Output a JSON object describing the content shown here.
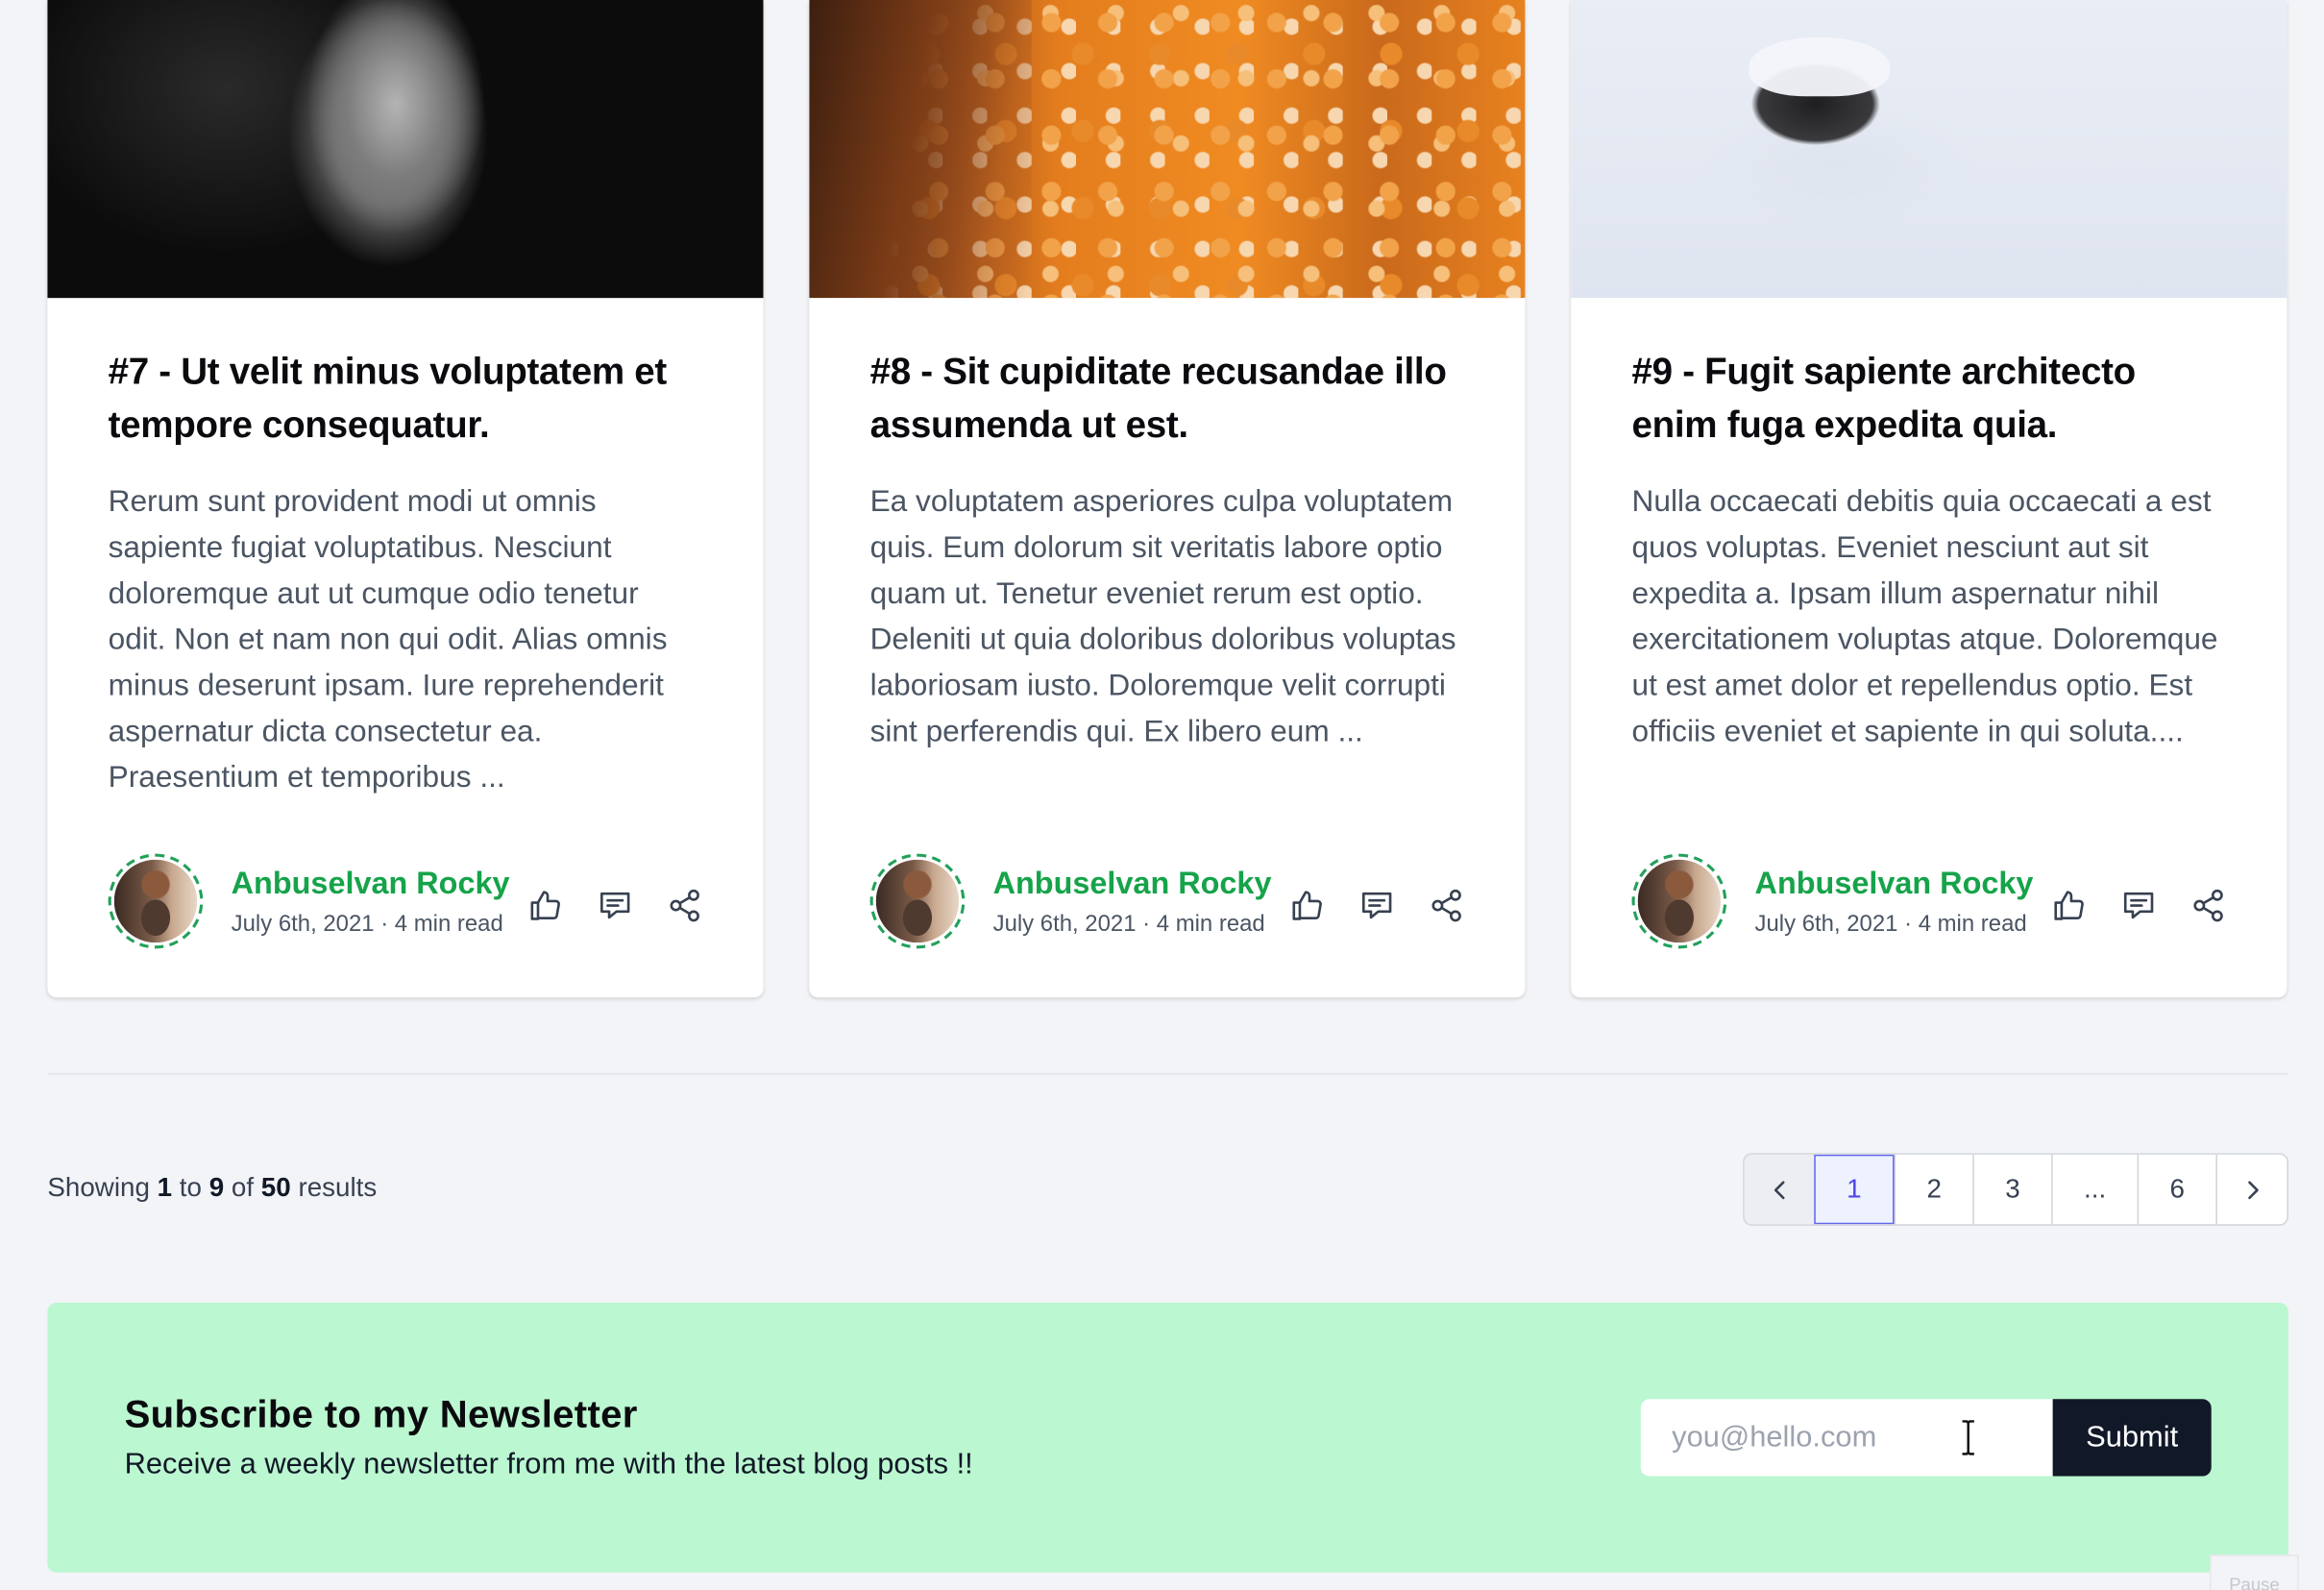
{
  "posts": [
    {
      "title": "#7 - Ut velit minus voluptatem et tempore consequatur.",
      "excerpt": "Rerum sunt provident modi ut omnis sapiente fugiat voluptatibus. Nesciunt doloremque aut ut cumque odio tenetur odit. Non et nam non qui odit. Alias omnis minus deserunt ipsam. Iure reprehenderit aspernatur dicta consectetur ea. Praesentium et temporibus ...",
      "author": "Anbuselvan Rocky",
      "meta": "July 6th, 2021 · 4 min read"
    },
    {
      "title": "#8 - Sit cupiditate recusandae illo assumenda ut est.",
      "excerpt": "Ea voluptatem asperiores culpa voluptatem quis. Eum dolorum sit veritatis labore optio quam ut. Tenetur eveniet rerum est optio. Deleniti ut quia doloribus doloribus voluptas laboriosam iusto. Doloremque velit corrupti sint perferendis qui. Ex libero eum ...",
      "author": "Anbuselvan Rocky",
      "meta": "July 6th, 2021 · 4 min read"
    },
    {
      "title": "#9 - Fugit sapiente architecto enim fuga expedita quia.",
      "excerpt": "Nulla occaecati debitis quia occaecati a est quos voluptas. Eveniet nesciunt aut sit expedita a. Ipsam illum aspernatur nihil exercitationem voluptas atque. Doloremque ut est amet dolor et repellendus optio. Est officiis eveniet et sapiente in qui soluta....",
      "author": "Anbuselvan Rocky",
      "meta": "July 6th, 2021 · 4 min read"
    }
  ],
  "results": {
    "prefix": "Showing",
    "from": "1",
    "to_word": "to",
    "to": "9",
    "of_word": "of",
    "total": "50",
    "suffix": "results"
  },
  "pagination": {
    "pages": [
      "1",
      "2",
      "3",
      "...",
      "6"
    ],
    "current": "1"
  },
  "newsletter": {
    "title": "Subscribe to my Newsletter",
    "subtitle": "Receive a weekly newsletter from me with the latest blog posts !!",
    "placeholder": "you@hello.com",
    "submit_label": "Submit"
  },
  "pause_label": "Pause",
  "colors": {
    "accent_green": "#16a34a",
    "newsletter_bg": "#bbf7d0",
    "submit_bg": "#111827",
    "active_page": "#4f46e5"
  }
}
